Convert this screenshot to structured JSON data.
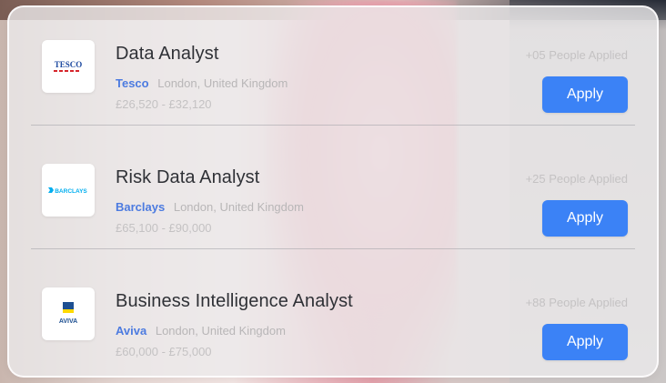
{
  "jobs": [
    {
      "logo_icon": "tesco-logo",
      "logo_text": "TESCO",
      "title": "Data Analyst",
      "company": "Tesco",
      "location": "London, United Kingdom",
      "salary": "£26,520 - £32,120",
      "applied": "+05 People Applied",
      "apply_label": "Apply"
    },
    {
      "logo_icon": "barclays-logo",
      "logo_text": "BARCLAYS",
      "title": "Risk Data Analyst",
      "company": "Barclays",
      "location": "London, United Kingdom",
      "salary": "£65,100 - £90,000",
      "applied": "+25 People Applied",
      "apply_label": "Apply"
    },
    {
      "logo_icon": "aviva-logo",
      "logo_text": "AVIVA",
      "title": "Business Intelligence Analyst",
      "company": "Aviva",
      "location": "London, United Kingdom",
      "salary": "£60,000 - £75,000",
      "applied": "+88 People Applied",
      "apply_label": "Apply"
    }
  ],
  "colors": {
    "accent": "#3b82f6",
    "company_link": "#4c7be0",
    "tesco_red": "#d6262c",
    "tesco_blue": "#1d4aa0",
    "barclays_blue": "#00aeef",
    "aviva_blue": "#1d4f91",
    "aviva_yellow": "#ffd900"
  }
}
